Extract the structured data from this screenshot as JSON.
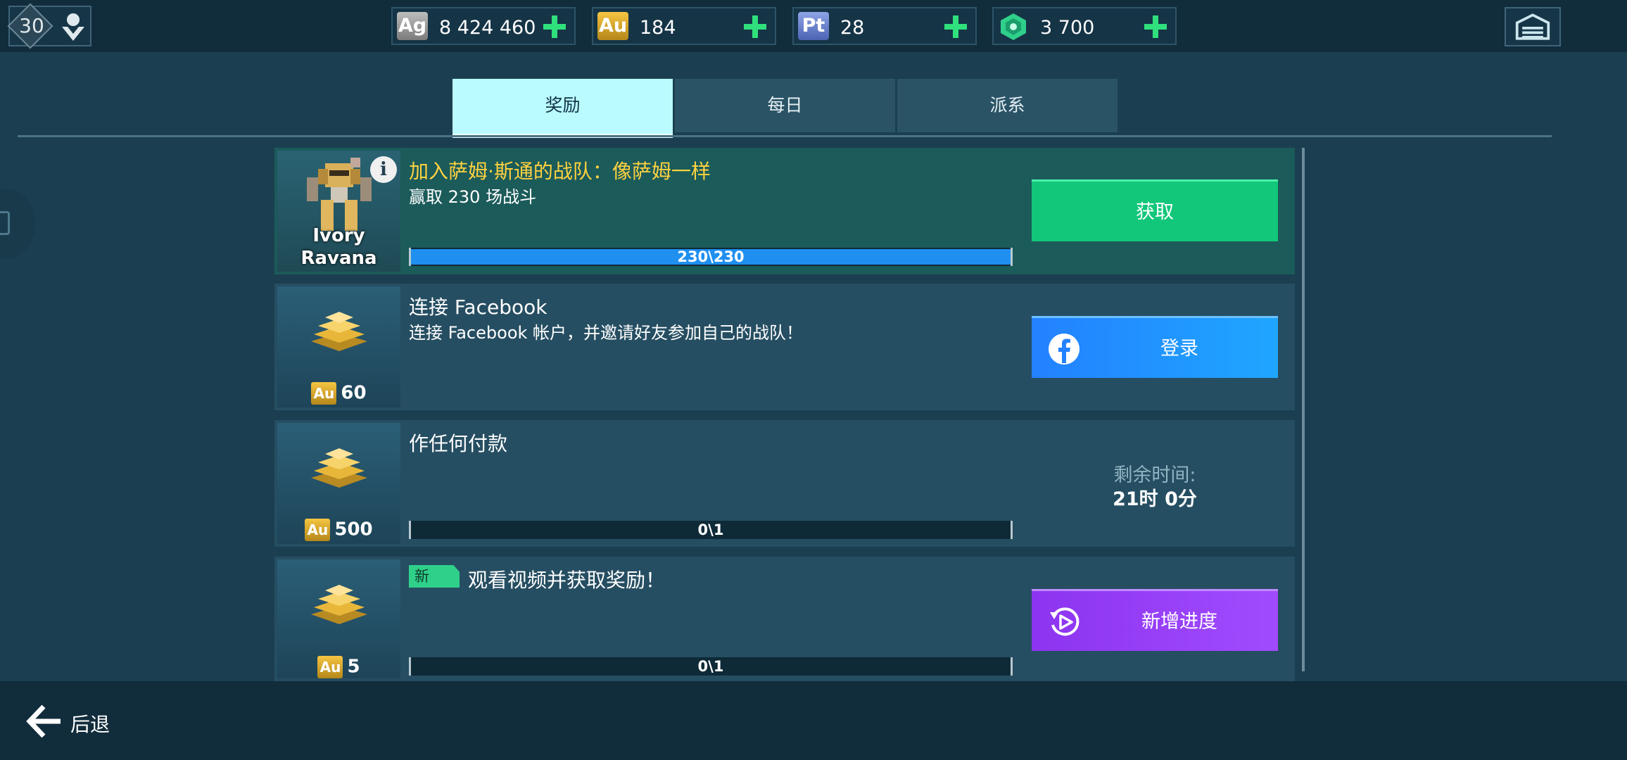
{
  "header": {
    "level": "30",
    "currencies": [
      {
        "code": "Ag",
        "value": "8 424 460",
        "color": "#9e9e9e"
      },
      {
        "code": "Au",
        "value": "184",
        "color": "#e0a92a"
      },
      {
        "code": "Pt",
        "value": "28",
        "color": "#6f85cf"
      },
      {
        "code": "",
        "value": "3 700",
        "color": "#2fd08a"
      }
    ]
  },
  "tabs": [
    {
      "label": "奖励",
      "active": true
    },
    {
      "label": "每日",
      "active": false
    },
    {
      "label": "派系",
      "active": false
    }
  ],
  "tasks": [
    {
      "title": "加入萨姆·斯通的战队：像萨姆一样",
      "desc": "赢取 230 场战斗",
      "reward_name_line1": "Ivory",
      "reward_name_line2": "Ravana",
      "progress_text": "230\\230",
      "progress_fraction": 1.0,
      "button": "获取"
    },
    {
      "title": "连接 Facebook",
      "desc": "连接 Facebook 帐户，并邀请好友参加自己的战队！",
      "reward_currency": "Au",
      "reward_amount": "60",
      "button": "登录"
    },
    {
      "title": "作任何付款",
      "reward_currency": "Au",
      "reward_amount": "500",
      "progress_text": "0\\1",
      "progress_fraction": 0,
      "timer_label": "剩余时间:",
      "timer_value": "21时 0分"
    },
    {
      "badge": "新",
      "title": "观看视频并获取奖励！",
      "reward_currency": "Au",
      "reward_amount": "5",
      "progress_text": "0\\1",
      "progress_fraction": 0,
      "button": "新增进度"
    }
  ],
  "footer": {
    "back_label": "后退"
  },
  "colors": {
    "background": "#1b3f50",
    "claim_green": "#12c77a",
    "facebook_blue": "#2381ff",
    "video_purple": "#8c34ef",
    "progress_blue": "#1f8ff0",
    "quest_title_gold": "#ffd23f"
  },
  "icons": [
    "user-icon",
    "garage-icon",
    "info-icon",
    "facebook-icon",
    "video-replay-icon",
    "back-arrow-icon",
    "gold-bars-icon",
    "robot-icon",
    "plus-icon"
  ]
}
